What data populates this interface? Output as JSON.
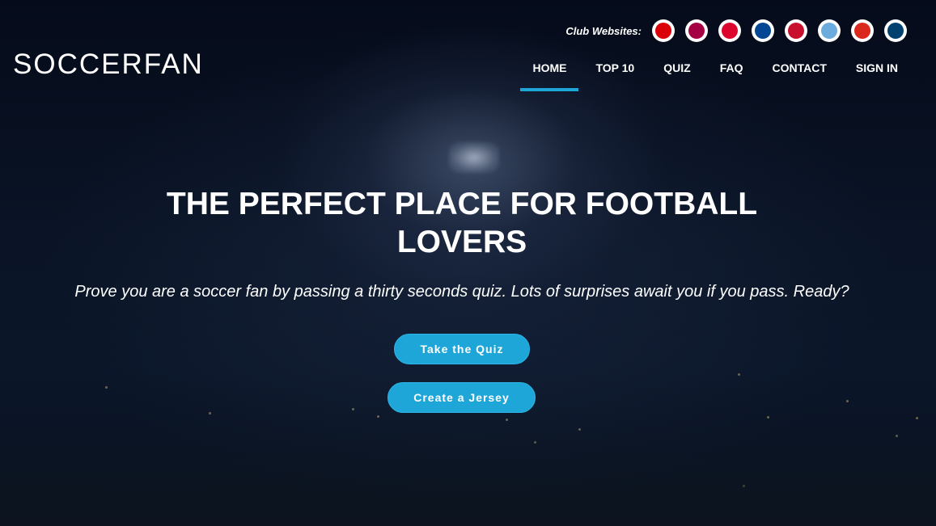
{
  "header": {
    "club_label": "Club Websites:",
    "clubs": [
      {
        "name": "arsenal-badge-icon",
        "color": "#db0007"
      },
      {
        "name": "barcelona-badge-icon",
        "color": "#a50044"
      },
      {
        "name": "bayern-badge-icon",
        "color": "#dc052d"
      },
      {
        "name": "chelsea-badge-icon",
        "color": "#034694"
      },
      {
        "name": "liverpool-badge-icon",
        "color": "#c8102e"
      },
      {
        "name": "man-city-badge-icon",
        "color": "#6cabdd"
      },
      {
        "name": "man-united-badge-icon",
        "color": "#da291c"
      },
      {
        "name": "psg-badge-icon",
        "color": "#004170"
      }
    ],
    "logo": "SOCCERFAN",
    "nav": [
      "HOME",
      "TOP 10",
      "QUIZ",
      "FAQ",
      "CONTACT",
      "SIGN IN"
    ],
    "active_nav": "HOME"
  },
  "hero": {
    "title_line1": "THE PERFECT PLACE FOR FOOTBALL",
    "title_line2": "LOVERS",
    "subtitle": "Prove you are a soccer fan by passing a thirty seconds quiz. Lots of surprises await you if you pass. Ready?",
    "quiz_button": "Take the Quiz",
    "jersey_button": "Create a Jersey"
  },
  "colors": {
    "accent": "#1fa6d8",
    "background": "#070d1d",
    "text": "#ffffff"
  }
}
